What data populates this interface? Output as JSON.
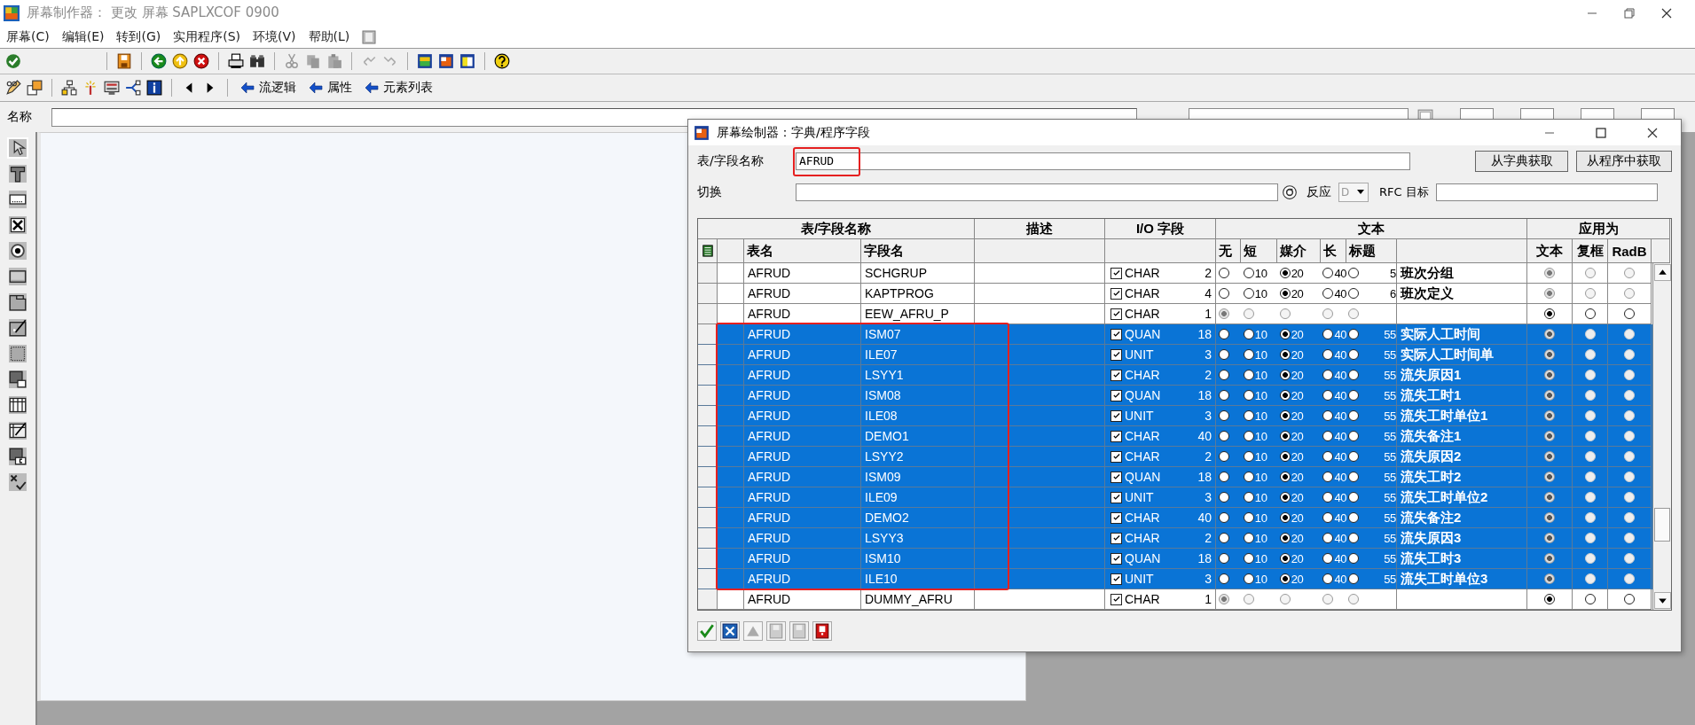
{
  "window": {
    "title": "屏幕制作器：  更改 屏幕 SAPLXCOF 0900"
  },
  "menu": [
    "屏幕(C)",
    "编辑(E)",
    "转到(G)",
    "实用程序(S)",
    "环境(V)",
    "帮助(L)"
  ],
  "toolbar2_buttons": [
    "流逻辑",
    "属性",
    "元素列表"
  ],
  "name_row": {
    "label": "名称"
  },
  "dialog": {
    "title": "屏幕绘制器：字典/程序字段",
    "name_label": "表/字段名称",
    "name_value": "AFRUD",
    "buttons": [
      "从字典获取",
      "从程序中获取"
    ],
    "switch_label": "切换",
    "response_label": "反应",
    "response_value": "D",
    "rfc_label": "RFC 目标",
    "table": {
      "header_groups": [
        "表/字段名称",
        "描述",
        "I/O 字段",
        "文本",
        "应用为"
      ],
      "columns": [
        "表名",
        "字段名"
      ],
      "size_columns": [
        "无",
        "短",
        "媒介",
        "长",
        "标题"
      ],
      "apply_columns": [
        "文本",
        "复框",
        "RadB"
      ],
      "rows": [
        {
          "selected": false,
          "table": "AFRUD",
          "field": "SCHGRUP",
          "checked": true,
          "type": "CHAR",
          "length": "2",
          "sizes_disabled": false,
          "sizes": [
            {
              "selected": false
            },
            {
              "label": "10",
              "selected": false
            },
            {
              "label": "20",
              "selected": true
            },
            {
              "label": "40",
              "selected": false
            },
            {
              "label": "5",
              "selected": false
            }
          ],
          "text": "班次分组",
          "apply_disabled": true,
          "apply": [
            {
              "selected": true
            },
            {
              "selected": false
            },
            {
              "selected": false
            }
          ]
        },
        {
          "selected": false,
          "table": "AFRUD",
          "field": "KAPTPROG",
          "checked": true,
          "type": "CHAR",
          "length": "4",
          "sizes_disabled": false,
          "sizes": [
            {
              "selected": false
            },
            {
              "label": "10",
              "selected": false
            },
            {
              "label": "20",
              "selected": true
            },
            {
              "label": "40",
              "selected": false
            },
            {
              "label": "6",
              "selected": false
            }
          ],
          "text": "班次定义",
          "apply_disabled": true,
          "apply": [
            {
              "selected": true
            },
            {
              "selected": false
            },
            {
              "selected": false
            }
          ]
        },
        {
          "selected": false,
          "table": "AFRUD",
          "field": "EEW_AFRU_P",
          "checked": true,
          "type": "CHAR",
          "length": "1",
          "sizes_disabled": true,
          "sizes": [
            {
              "selected": true
            },
            {
              "selected": false
            },
            {
              "selected": false
            },
            {
              "selected": false
            },
            {
              "selected": false
            }
          ],
          "apply_disabled": false,
          "apply": [
            {
              "selected": true
            },
            {
              "selected": false
            },
            {
              "selected": false
            }
          ]
        },
        {
          "selected": true,
          "table": "AFRUD",
          "field": "ISM07",
          "checked": true,
          "type": "QUAN",
          "length": "18",
          "sizes_disabled": false,
          "sizes": [
            {
              "selected": false
            },
            {
              "label": "10",
              "selected": false
            },
            {
              "label": "20",
              "selected": true
            },
            {
              "label": "40",
              "selected": false
            },
            {
              "label": "55",
              "selected": false
            }
          ],
          "text": "实际人工时间",
          "apply_disabled": true,
          "apply": [
            {
              "selected": true
            },
            {
              "selected": false
            },
            {
              "selected": false
            }
          ]
        },
        {
          "selected": true,
          "table": "AFRUD",
          "field": "ILE07",
          "checked": true,
          "type": "UNIT",
          "length": "3",
          "sizes_disabled": false,
          "sizes": [
            {
              "selected": false
            },
            {
              "label": "10",
              "selected": false
            },
            {
              "label": "20",
              "selected": true
            },
            {
              "label": "40",
              "selected": false
            },
            {
              "label": "55",
              "selected": false
            }
          ],
          "text": "实际人工时间单",
          "apply_disabled": true,
          "apply": [
            {
              "selected": true
            },
            {
              "selected": false
            },
            {
              "selected": false
            }
          ]
        },
        {
          "selected": true,
          "table": "AFRUD",
          "field": "LSYY1",
          "checked": true,
          "type": "CHAR",
          "length": "2",
          "sizes_disabled": false,
          "sizes": [
            {
              "selected": false
            },
            {
              "label": "10",
              "selected": false
            },
            {
              "label": "20",
              "selected": true
            },
            {
              "label": "40",
              "selected": false
            },
            {
              "label": "55",
              "selected": false
            }
          ],
          "text": "流失原因1",
          "apply_disabled": true,
          "apply": [
            {
              "selected": true
            },
            {
              "selected": false
            },
            {
              "selected": false
            }
          ]
        },
        {
          "selected": true,
          "table": "AFRUD",
          "field": "ISM08",
          "checked": true,
          "type": "QUAN",
          "length": "18",
          "sizes_disabled": false,
          "sizes": [
            {
              "selected": false
            },
            {
              "label": "10",
              "selected": false
            },
            {
              "label": "20",
              "selected": true
            },
            {
              "label": "40",
              "selected": false
            },
            {
              "label": "55",
              "selected": false
            }
          ],
          "text": "流失工时1",
          "apply_disabled": true,
          "apply": [
            {
              "selected": true
            },
            {
              "selected": false
            },
            {
              "selected": false
            }
          ]
        },
        {
          "selected": true,
          "table": "AFRUD",
          "field": "ILE08",
          "checked": true,
          "type": "UNIT",
          "length": "3",
          "sizes_disabled": false,
          "sizes": [
            {
              "selected": false
            },
            {
              "label": "10",
              "selected": false
            },
            {
              "label": "20",
              "selected": true
            },
            {
              "label": "40",
              "selected": false
            },
            {
              "label": "55",
              "selected": false
            }
          ],
          "text": "流失工时单位1",
          "apply_disabled": true,
          "apply": [
            {
              "selected": true
            },
            {
              "selected": false
            },
            {
              "selected": false
            }
          ]
        },
        {
          "selected": true,
          "table": "AFRUD",
          "field": "DEMO1",
          "checked": true,
          "type": "CHAR",
          "length": "40",
          "sizes_disabled": false,
          "sizes": [
            {
              "selected": false
            },
            {
              "label": "10",
              "selected": false
            },
            {
              "label": "20",
              "selected": true
            },
            {
              "label": "40",
              "selected": false
            },
            {
              "label": "55",
              "selected": false
            }
          ],
          "text": "流失备注1",
          "apply_disabled": true,
          "apply": [
            {
              "selected": true
            },
            {
              "selected": false
            },
            {
              "selected": false
            }
          ]
        },
        {
          "selected": true,
          "table": "AFRUD",
          "field": "LSYY2",
          "checked": true,
          "type": "CHAR",
          "length": "2",
          "sizes_disabled": false,
          "sizes": [
            {
              "selected": false
            },
            {
              "label": "10",
              "selected": false
            },
            {
              "label": "20",
              "selected": true
            },
            {
              "label": "40",
              "selected": false
            },
            {
              "label": "55",
              "selected": false
            }
          ],
          "text": "流失原因2",
          "apply_disabled": true,
          "apply": [
            {
              "selected": true
            },
            {
              "selected": false
            },
            {
              "selected": false
            }
          ]
        },
        {
          "selected": true,
          "table": "AFRUD",
          "field": "ISM09",
          "checked": true,
          "type": "QUAN",
          "length": "18",
          "sizes_disabled": false,
          "sizes": [
            {
              "selected": false
            },
            {
              "label": "10",
              "selected": false
            },
            {
              "label": "20",
              "selected": true
            },
            {
              "label": "40",
              "selected": false
            },
            {
              "label": "55",
              "selected": false
            }
          ],
          "text": "流失工时2",
          "apply_disabled": true,
          "apply": [
            {
              "selected": true
            },
            {
              "selected": false
            },
            {
              "selected": false
            }
          ]
        },
        {
          "selected": true,
          "table": "AFRUD",
          "field": "ILE09",
          "checked": true,
          "type": "UNIT",
          "length": "3",
          "sizes_disabled": false,
          "sizes": [
            {
              "selected": false
            },
            {
              "label": "10",
              "selected": false
            },
            {
              "label": "20",
              "selected": true
            },
            {
              "label": "40",
              "selected": false
            },
            {
              "label": "55",
              "selected": false
            }
          ],
          "text": "流失工时单位2",
          "apply_disabled": true,
          "apply": [
            {
              "selected": true
            },
            {
              "selected": false
            },
            {
              "selected": false
            }
          ]
        },
        {
          "selected": true,
          "table": "AFRUD",
          "field": "DEMO2",
          "checked": true,
          "type": "CHAR",
          "length": "40",
          "sizes_disabled": false,
          "sizes": [
            {
              "selected": false
            },
            {
              "label": "10",
              "selected": false
            },
            {
              "label": "20",
              "selected": true
            },
            {
              "label": "40",
              "selected": false
            },
            {
              "label": "55",
              "selected": false
            }
          ],
          "text": "流失备注2",
          "apply_disabled": true,
          "apply": [
            {
              "selected": true
            },
            {
              "selected": false
            },
            {
              "selected": false
            }
          ]
        },
        {
          "selected": true,
          "table": "AFRUD",
          "field": "LSYY3",
          "checked": true,
          "type": "CHAR",
          "length": "2",
          "sizes_disabled": false,
          "sizes": [
            {
              "selected": false
            },
            {
              "label": "10",
              "selected": false
            },
            {
              "label": "20",
              "selected": true
            },
            {
              "label": "40",
              "selected": false
            },
            {
              "label": "55",
              "selected": false
            }
          ],
          "text": "流失原因3",
          "apply_disabled": true,
          "apply": [
            {
              "selected": true
            },
            {
              "selected": false
            },
            {
              "selected": false
            }
          ]
        },
        {
          "selected": true,
          "table": "AFRUD",
          "field": "ISM10",
          "checked": true,
          "type": "QUAN",
          "length": "18",
          "sizes_disabled": false,
          "sizes": [
            {
              "selected": false
            },
            {
              "label": "10",
              "selected": false
            },
            {
              "label": "20",
              "selected": true
            },
            {
              "label": "40",
              "selected": false
            },
            {
              "label": "55",
              "selected": false
            }
          ],
          "text": "流失工时3",
          "apply_disabled": true,
          "apply": [
            {
              "selected": true
            },
            {
              "selected": false
            },
            {
              "selected": false
            }
          ]
        },
        {
          "selected": true,
          "table": "AFRUD",
          "field": "ILE10",
          "checked": true,
          "type": "UNIT",
          "length": "3",
          "sizes_disabled": false,
          "sizes": [
            {
              "selected": false
            },
            {
              "label": "10",
              "selected": false
            },
            {
              "label": "20",
              "selected": true
            },
            {
              "label": "40",
              "selected": false
            },
            {
              "label": "55",
              "selected": false
            }
          ],
          "text": "流失工时单位3",
          "apply_disabled": true,
          "apply": [
            {
              "selected": true
            },
            {
              "selected": false
            },
            {
              "selected": false
            }
          ]
        },
        {
          "selected": false,
          "table": "AFRUD",
          "field": "DUMMY_AFRU",
          "checked": true,
          "type": "CHAR",
          "length": "1",
          "sizes_disabled": true,
          "sizes": [
            {
              "selected": true
            },
            {
              "selected": false
            },
            {
              "selected": false
            },
            {
              "selected": false
            },
            {
              "selected": false
            }
          ],
          "apply_disabled": false,
          "apply": [
            {
              "selected": true
            },
            {
              "selected": false
            },
            {
              "selected": false
            }
          ]
        }
      ]
    }
  }
}
